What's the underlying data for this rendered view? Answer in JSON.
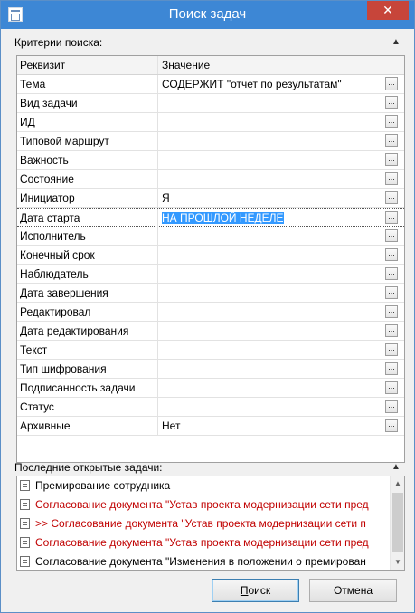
{
  "window": {
    "title": "Поиск задач",
    "close_glyph": "✕"
  },
  "criteria": {
    "header": "Критерии поиска:",
    "columns": {
      "name": "Реквизит",
      "value": "Значение"
    },
    "ellipsis": "...",
    "rows": [
      {
        "name": "Тема",
        "value": "СОДЕРЖИТ \"отчет по результатам\""
      },
      {
        "name": "Вид задачи",
        "value": ""
      },
      {
        "name": "ИД",
        "value": ""
      },
      {
        "name": "Типовой маршрут",
        "value": ""
      },
      {
        "name": "Важность",
        "value": ""
      },
      {
        "name": "Состояние",
        "value": ""
      },
      {
        "name": "Инициатор",
        "value": "Я"
      },
      {
        "name": "Дата старта",
        "value": "НА ПРОШЛОЙ НЕДЕЛЕ",
        "selected": true
      },
      {
        "name": "Исполнитель",
        "value": ""
      },
      {
        "name": "Конечный срок",
        "value": ""
      },
      {
        "name": "Наблюдатель",
        "value": ""
      },
      {
        "name": "Дата завершения",
        "value": ""
      },
      {
        "name": "Редактировал",
        "value": ""
      },
      {
        "name": "Дата редактирования",
        "value": ""
      },
      {
        "name": "Текст",
        "value": ""
      },
      {
        "name": "Тип шифрования",
        "value": ""
      },
      {
        "name": "Подписанность задачи",
        "value": ""
      },
      {
        "name": "Статус",
        "value": ""
      },
      {
        "name": "Архивные",
        "value": "Нет"
      }
    ]
  },
  "recent": {
    "header": "Последние открытые задачи:",
    "items": [
      {
        "text": "Премирование сотрудника",
        "red": false
      },
      {
        "text": "Согласование документа \"Устав проекта модернизации сети пред",
        "red": true
      },
      {
        "text": ">> Согласование документа \"Устав проекта модернизации сети п",
        "red": true
      },
      {
        "text": "Согласование документа \"Устав проекта модернизации сети пред",
        "red": true
      },
      {
        "text": "Согласование документа \"Изменения в положении о премирован",
        "red": false
      }
    ]
  },
  "buttons": {
    "search_mnemonic": "П",
    "search_rest": "оиск",
    "cancel": "Отмена"
  }
}
